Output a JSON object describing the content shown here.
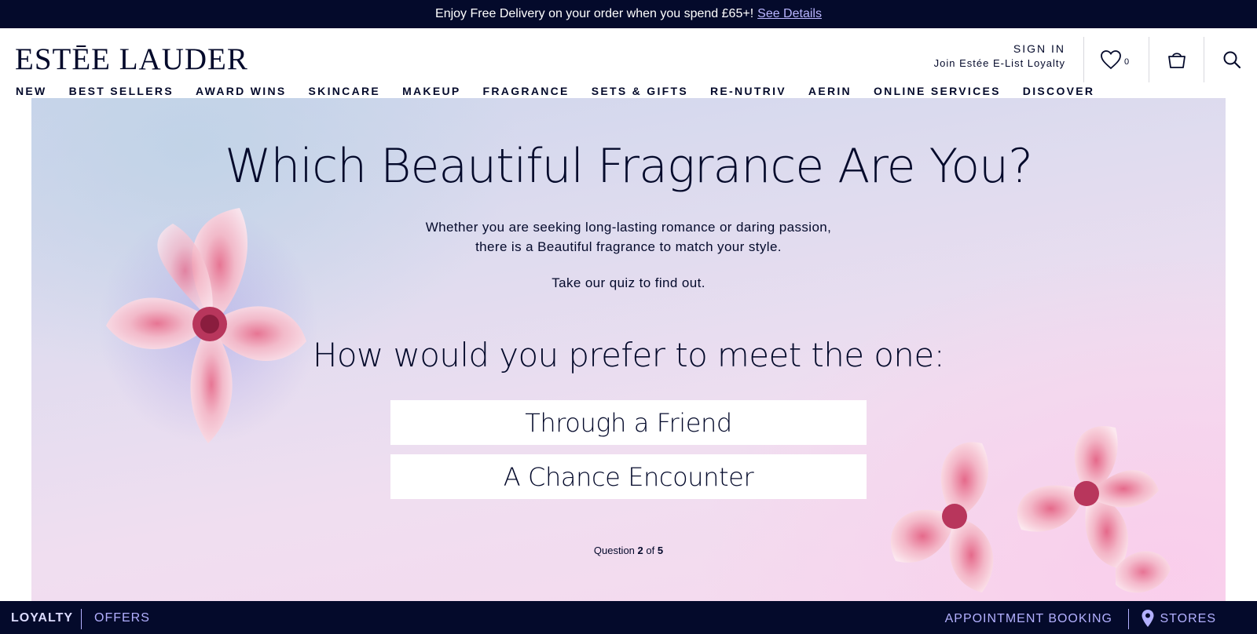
{
  "promo": {
    "text": "Enjoy Free Delivery on your order when you spend £65+!",
    "link": "See Details"
  },
  "header": {
    "logo": "ESTĒE LAUDER",
    "sign_in": "SIGN IN",
    "join": "Join Estée E-List Loyalty",
    "wishlist_count": "0",
    "icons": [
      "heart-icon",
      "shopping-bag-icon",
      "search-icon"
    ]
  },
  "nav": {
    "items": [
      "NEW",
      "BEST SELLERS",
      "AWARD WINS",
      "SKINCARE",
      "MAKEUP",
      "FRAGRANCE",
      "SETS & GIFTS",
      "RE-NUTRIV",
      "AERIN",
      "ONLINE SERVICES",
      "DISCOVER"
    ]
  },
  "quiz": {
    "title": "Which Beautiful Fragrance Are You?",
    "intro_line1": "Whether you are seeking long-lasting romance or daring passion,",
    "intro_line2": "there is a Beautiful fragrance to match your style.",
    "cta": "Take our quiz to find out.",
    "question": "How would you prefer to meet the one:",
    "answers": [
      "Through a Friend",
      "A Chance Encounter"
    ],
    "progress_label": "Question",
    "progress_current": "2",
    "progress_of": "of",
    "progress_total": "5"
  },
  "footer": {
    "loyalty": "LOYALTY",
    "offers": "OFFERS",
    "appointment": "APPOINTMENT BOOKING",
    "stores": "STORES",
    "pin_icon": "location-pin-icon"
  },
  "colors": {
    "navy": "#040a2b",
    "link_lavender": "#b9b6ff",
    "footer_text": "#b3b0ff"
  }
}
